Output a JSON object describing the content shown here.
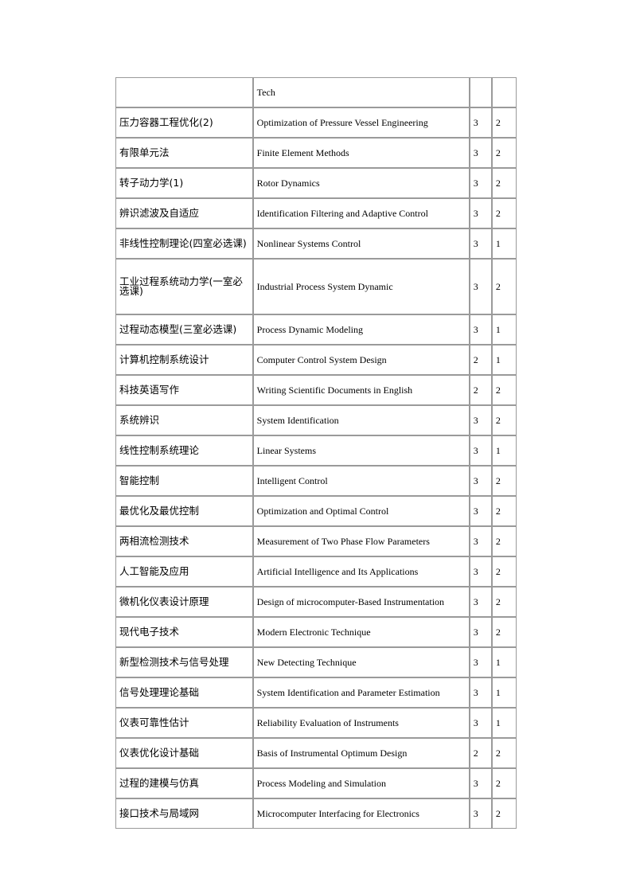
{
  "page": {
    "background_color": "#ffffff",
    "border_color": "#9a9a9a",
    "text_color": "#000000"
  },
  "table": {
    "columns": [
      {
        "key": "course_cn",
        "label": ""
      },
      {
        "key": "course_en",
        "label": ""
      },
      {
        "key": "credits",
        "label": ""
      },
      {
        "key": "semester",
        "label": ""
      }
    ],
    "rows": [
      {
        "course_cn": "",
        "course_en": "Tech",
        "credits": "",
        "semester": "",
        "style": "first"
      },
      {
        "course_cn": "压力容器工程优化(2)",
        "course_en": "Optimization of Pressure Vessel Engineering",
        "credits": "3",
        "semester": "2",
        "style": "normal"
      },
      {
        "course_cn": "有限单元法",
        "course_en": "Finite Element Methods",
        "credits": "3",
        "semester": "2",
        "style": "normal"
      },
      {
        "course_cn": "转子动力学(1)",
        "course_en": "Rotor Dynamics",
        "credits": "3",
        "semester": "2",
        "style": "normal"
      },
      {
        "course_cn": "辨识滤波及自适应",
        "course_en": "Identification Filtering and Adaptive Control",
        "credits": "3",
        "semester": "2",
        "style": "normal"
      },
      {
        "course_cn": "非线性控制理论(四室必选课)",
        "course_en": "Nonlinear Systems Control",
        "credits": "3",
        "semester": "1",
        "style": "normal"
      },
      {
        "course_cn": "工业过程系统动力学(一室必选课)",
        "course_en": "Industrial Process System Dynamic",
        "credits": "3",
        "semester": "2",
        "style": "tall"
      },
      {
        "course_cn": "过程动态模型(三室必选课)",
        "course_en": "Process Dynamic Modeling",
        "credits": "3",
        "semester": "1",
        "style": "normal"
      },
      {
        "course_cn": "计算机控制系统设计",
        "course_en": "Computer Control System Design",
        "credits": "2",
        "semester": "1",
        "style": "normal"
      },
      {
        "course_cn": "科技英语写作",
        "course_en": "Writing Scientific Documents in English",
        "credits": "2",
        "semester": "2",
        "style": "normal"
      },
      {
        "course_cn": "系统辨识",
        "course_en": "System Identification",
        "credits": "3",
        "semester": "2",
        "style": "normal"
      },
      {
        "course_cn": "线性控制系统理论",
        "course_en": "Linear Systems",
        "credits": "3",
        "semester": "1",
        "style": "normal"
      },
      {
        "course_cn": "智能控制",
        "course_en": "Intelligent Control",
        "credits": "3",
        "semester": "2",
        "style": "normal"
      },
      {
        "course_cn": "最优化及最优控制",
        "course_en": "Optimization and Optimal Control",
        "credits": "3",
        "semester": "2",
        "style": "normal"
      },
      {
        "course_cn": "两相流检测技术",
        "course_en": "Measurement of Two Phase Flow Parameters",
        "credits": "3",
        "semester": "2",
        "style": "normal"
      },
      {
        "course_cn": "人工智能及应用",
        "course_en": "Artificial Intelligence and Its Applications",
        "credits": "3",
        "semester": "2",
        "style": "normal"
      },
      {
        "course_cn": "微机化仪表设计原理",
        "course_en": "Design of microcomputer-Based Instrumentation",
        "credits": "3",
        "semester": "2",
        "style": "normal"
      },
      {
        "course_cn": "现代电子技术",
        "course_en": "Modern Electronic Technique",
        "credits": "3",
        "semester": "2",
        "style": "normal"
      },
      {
        "course_cn": "新型检测技术与信号处理",
        "course_en": "New Detecting Technique",
        "credits": "3",
        "semester": "1",
        "style": "normal"
      },
      {
        "course_cn": "信号处理理论基础",
        "course_en": "System Identification and Parameter Estimation",
        "credits": "3",
        "semester": "1",
        "style": "normal"
      },
      {
        "course_cn": "仪表可靠性估计",
        "course_en": "Reliability Evaluation of Instruments",
        "credits": "3",
        "semester": "1",
        "style": "normal"
      },
      {
        "course_cn": "仪表优化设计基础",
        "course_en": "Basis of Instrumental Optimum Design",
        "credits": "2",
        "semester": "2",
        "style": "normal"
      },
      {
        "course_cn": "过程的建模与仿真",
        "course_en": "Process Modeling and Simulation",
        "credits": "3",
        "semester": "2",
        "style": "normal"
      },
      {
        "course_cn": "接口技术与局域网",
        "course_en": "Microcomputer Interfacing for Electronics",
        "credits": "3",
        "semester": "2",
        "style": "normal"
      }
    ]
  }
}
